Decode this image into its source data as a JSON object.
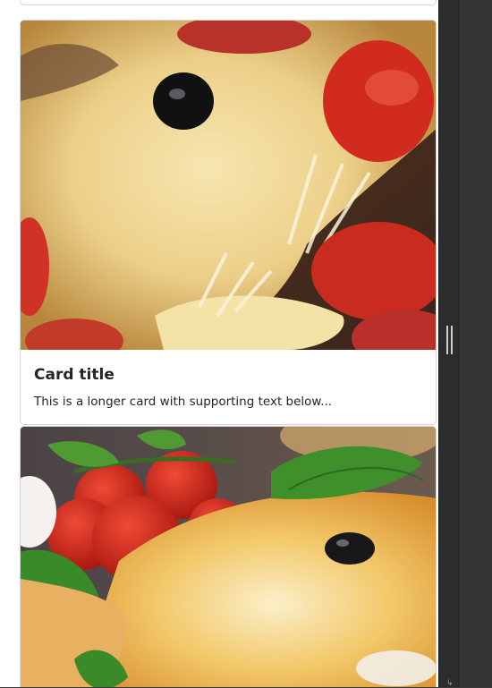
{
  "cards": [
    {
      "image": "pizza-cheese-pull-photo",
      "title": "Card title",
      "text": "This is a longer card with supporting text below..."
    },
    {
      "image": "pizza-slice-basil-tomato-photo"
    }
  ],
  "colors": {
    "page_background": "#ffffff",
    "card_border": "#d6d6d6",
    "text": "#212529",
    "devtools_background": "#353535"
  }
}
